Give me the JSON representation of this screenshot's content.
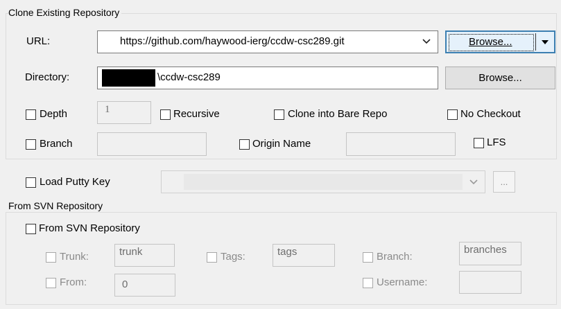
{
  "clone_group": {
    "title": "Clone Existing Repository",
    "url_label": "URL:",
    "url_value": "https://github.com/haywood-ierg/ccdw-csc289.git",
    "browse_url_label": "Browse...",
    "directory_label": "Directory:",
    "directory_value": "\\ccdw-csc289",
    "browse_dir_label": "Browse...",
    "depth_label": "Depth",
    "depth_value": "1",
    "recursive_label": "Recursive",
    "bare_label": "Clone into Bare Repo",
    "no_checkout_label": "No Checkout",
    "branch_label": "Branch",
    "branch_value": "",
    "origin_label": "Origin Name",
    "origin_value": "",
    "lfs_label": "LFS"
  },
  "putty": {
    "label": "Load Putty Key",
    "value": "",
    "ellipsis": "..."
  },
  "svn_group": {
    "title": "From SVN Repository",
    "from_svn_label": "From SVN Repository",
    "trunk_label": "Trunk:",
    "trunk_value": "trunk",
    "tags_label": "Tags:",
    "tags_value": "tags",
    "branch_label": "Branch:",
    "branch_value": "branches",
    "from_label": "From:",
    "from_value": "0",
    "username_label": "Username:",
    "username_value": ""
  },
  "icons": {
    "dropdown": "chevron-down-icon",
    "split": "split-arrow-icon"
  }
}
